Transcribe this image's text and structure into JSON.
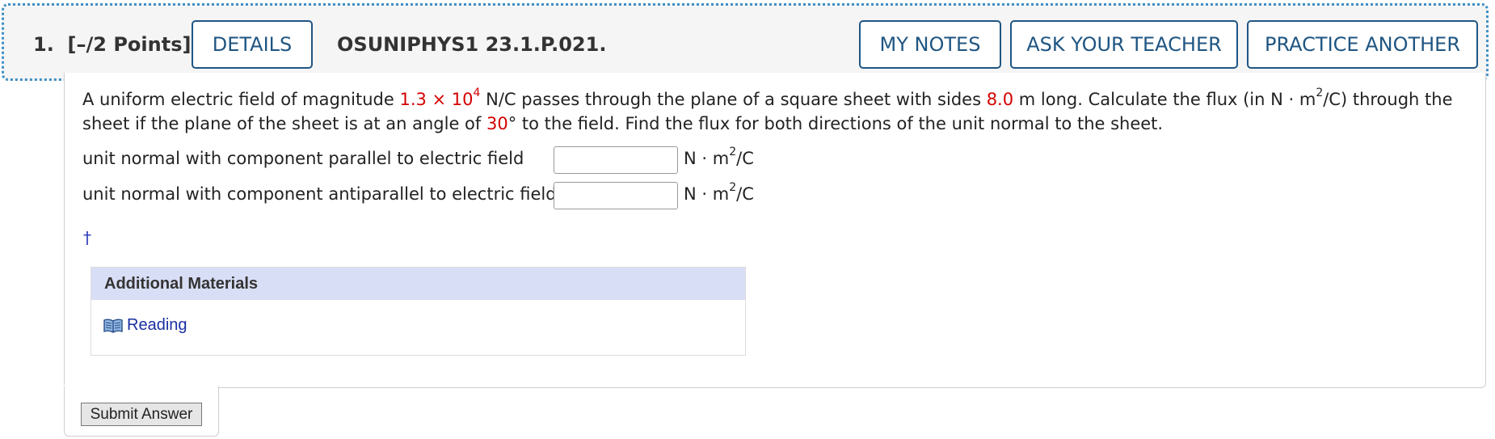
{
  "header": {
    "question_number": "1.",
    "points": "[–/2 Points]",
    "details_label": "DETAILS",
    "question_code": "OSUNIPHYS1 23.1.P.021.",
    "my_notes_label": "MY NOTES",
    "ask_teacher_label": "ASK YOUR TEACHER",
    "practice_label": "PRACTICE ANOTHER"
  },
  "question": {
    "part1": "A uniform electric field of magnitude ",
    "field_mantissa": "1.3 × 10",
    "field_exponent": "4",
    "part2": " N/C passes through the plane of a square sheet with sides ",
    "side_length": "8.0",
    "part3": " m long. Calculate the flux (in N · m",
    "part3_exp": "2",
    "part4": "/C) through the sheet if the plane of the sheet is at an angle of ",
    "angle": "30",
    "part5": "° to the field. Find the flux for both directions of the unit normal to the sheet."
  },
  "answers": [
    {
      "label": "unit normal with component parallel to electric field",
      "value": "",
      "unit_pre": "N · m",
      "unit_exp": "2",
      "unit_post": "/C"
    },
    {
      "label": "unit normal with component antiparallel to electric field",
      "value": "",
      "unit_pre": "N · m",
      "unit_exp": "2",
      "unit_post": "/C"
    }
  ],
  "dagger": "†",
  "materials": {
    "heading": "Additional Materials",
    "icon": "book-icon",
    "reading_label": "Reading"
  },
  "submit_label": "Submit Answer",
  "colors": {
    "accent": "#1f5582",
    "given_value": "#d40000",
    "focus_outline": "#3f8fc6",
    "materials_header": "#d8def5",
    "link": "#1a2fa0"
  }
}
